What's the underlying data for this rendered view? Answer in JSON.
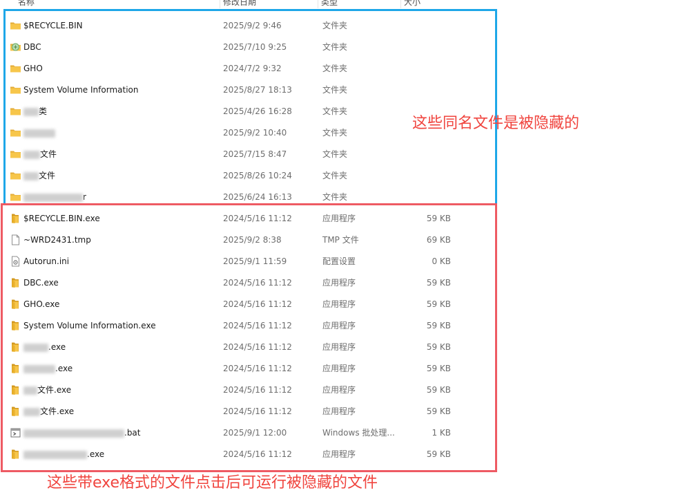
{
  "header": {
    "name": "名称",
    "date": "修改日期",
    "type": "类型",
    "size": "大小"
  },
  "rows": [
    {
      "icon": "folder-icon",
      "name": "$RECYCLE.BIN",
      "date": "2025/9/2 9:46",
      "type": "文件夹",
      "size": ""
    },
    {
      "icon": "folder-special-icon",
      "name": "DBC",
      "date": "2025/7/10 9:25",
      "type": "文件夹",
      "size": ""
    },
    {
      "icon": "folder-icon",
      "name": "GHO",
      "date": "2024/7/2 9:32",
      "type": "文件夹",
      "size": ""
    },
    {
      "icon": "folder-icon",
      "name": "System Volume Information",
      "date": "2025/8/27 18:13",
      "type": "文件夹",
      "size": ""
    },
    {
      "icon": "folder-icon",
      "name": "类",
      "date": "2025/4/26 16:28",
      "type": "文件夹",
      "size": ""
    },
    {
      "icon": "folder-icon",
      "name": "",
      "date": "2025/9/2 10:40",
      "type": "文件夹",
      "size": ""
    },
    {
      "icon": "folder-icon",
      "name": "文件",
      "date": "2025/7/15 8:47",
      "type": "文件夹",
      "size": ""
    },
    {
      "icon": "folder-icon",
      "name": "文件",
      "date": "2025/8/26 10:24",
      "type": "文件夹",
      "size": ""
    },
    {
      "icon": "folder-icon",
      "name": "r",
      "date": "2025/6/24 16:13",
      "type": "文件夹",
      "size": ""
    },
    {
      "icon": "exe-folder-icon",
      "name": "$RECYCLE.BIN.exe",
      "date": "2024/5/16 11:12",
      "type": "应用程序",
      "size": "59 KB"
    },
    {
      "icon": "file-icon",
      "name": "~WRD2431.tmp",
      "date": "2025/9/2 8:38",
      "type": "TMP 文件",
      "size": "69 KB"
    },
    {
      "icon": "settings-file-icon",
      "name": "Autorun.ini",
      "date": "2025/9/1 11:59",
      "type": "配置设置",
      "size": "0 KB"
    },
    {
      "icon": "exe-folder-icon",
      "name": "DBC.exe",
      "date": "2024/5/16 11:12",
      "type": "应用程序",
      "size": "59 KB"
    },
    {
      "icon": "exe-folder-icon",
      "name": "GHO.exe",
      "date": "2024/5/16 11:12",
      "type": "应用程序",
      "size": "59 KB"
    },
    {
      "icon": "exe-folder-icon",
      "name": "System Volume Information.exe",
      "date": "2024/5/16 11:12",
      "type": "应用程序",
      "size": "59 KB"
    },
    {
      "icon": "exe-folder-icon",
      "name": ".exe",
      "date": "2024/5/16 11:12",
      "type": "应用程序",
      "size": "59 KB"
    },
    {
      "icon": "exe-folder-icon",
      "name": ".exe",
      "date": "2024/5/16 11:12",
      "type": "应用程序",
      "size": "59 KB"
    },
    {
      "icon": "exe-folder-icon",
      "name": "文件.exe",
      "date": "2024/5/16 11:12",
      "type": "应用程序",
      "size": "59 KB"
    },
    {
      "icon": "exe-folder-icon",
      "name": "文件.exe",
      "date": "2024/5/16 11:12",
      "type": "应用程序",
      "size": "59 KB"
    },
    {
      "icon": "batch-file-icon",
      "name": ".bat",
      "date": "2025/9/1 12:00",
      "type": "Windows 批处理...",
      "size": "1 KB"
    },
    {
      "icon": "exe-folder-icon",
      "name": ".exe",
      "date": "2024/5/16 11:12",
      "type": "应用程序",
      "size": "59 KB"
    }
  ],
  "annotations": {
    "hidden_note": "这些同名文件是被隐藏的",
    "exe_note": "这些带exe格式的文件点击后可运行被隐藏的文件"
  },
  "colors": {
    "blue_box": "#1ea7e8",
    "red_box": "#ee5a63",
    "note_text": "#f0443e",
    "folder": "#f7c64b"
  }
}
